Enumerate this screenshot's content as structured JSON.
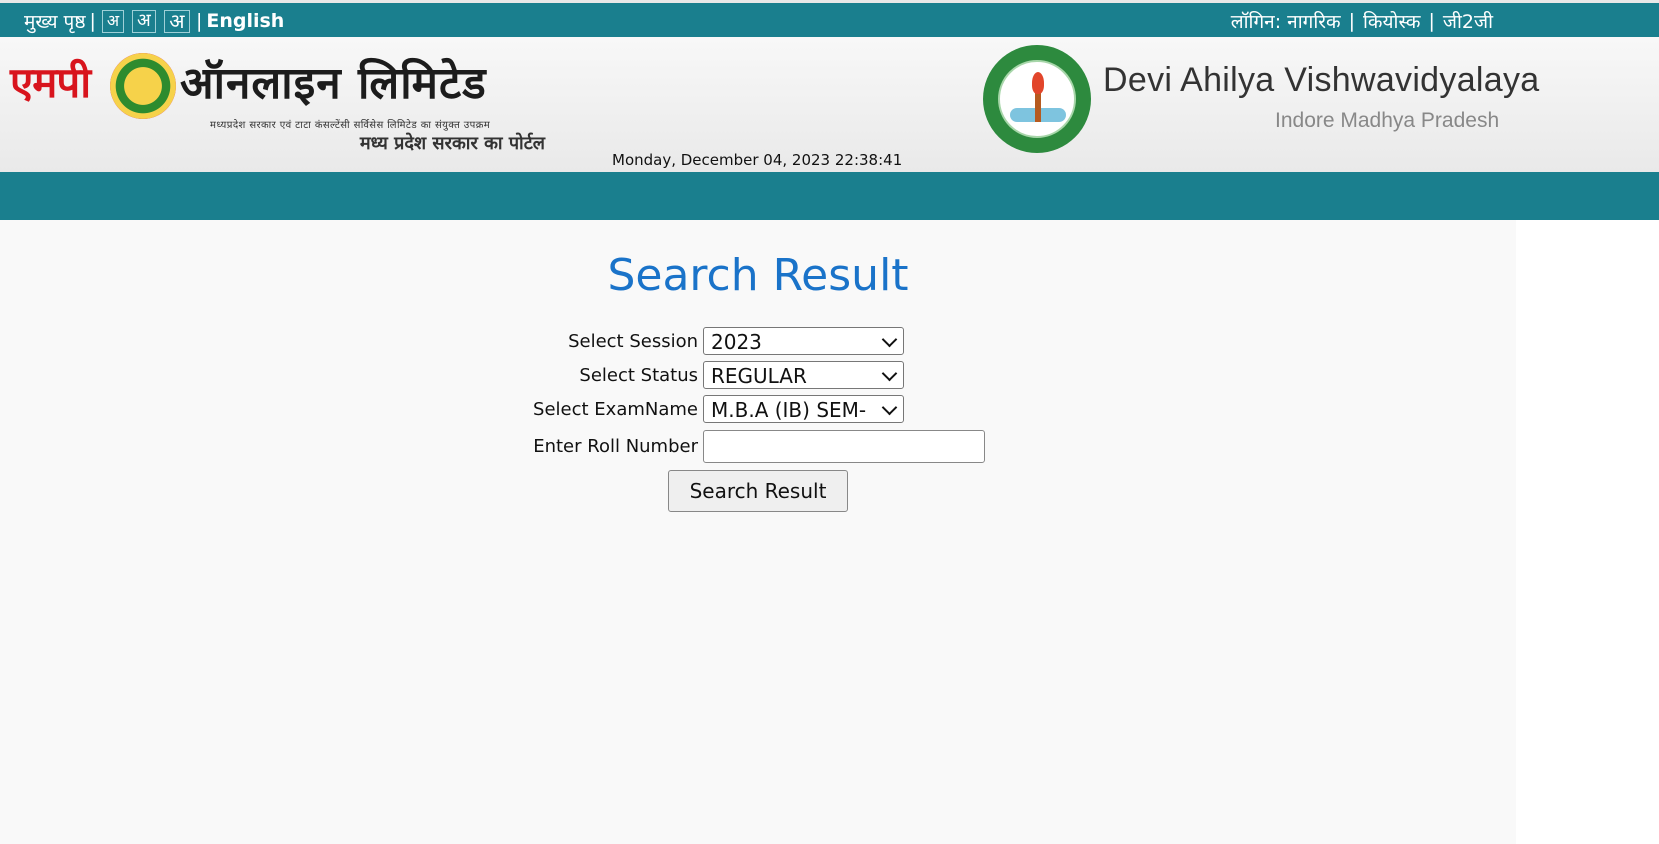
{
  "topbar": {
    "home_label": "मुख्य पृष्ठ",
    "font_small": "अ",
    "font_medium": "अ",
    "font_large": "अ",
    "english_label": "English",
    "login_label": "लॉगिन: नागरिक",
    "kiosk_label": "कियोस्क",
    "g2g_label": "जी2जी"
  },
  "header": {
    "mp_logo_word1": "एमपी",
    "mp_logo_word2": "ऑनलाइन  लिमिटेड",
    "mp_tagline": "मध्यप्रदेश सरकार एवं टाटा कंसल्टेंसी सर्विसेस लिमिटेड का संयुक्त उपक्रम",
    "mp_portal": "मध्य प्रदेश सरकार का पोर्टल",
    "datetime": "Monday, December 04, 2023 22:38:41",
    "university_name": "Devi Ahilya Vishwavidyalaya",
    "university_location": "Indore Madhya Pradesh"
  },
  "main": {
    "title": "Search Result",
    "session_label": "Select Session",
    "session_value": "2023",
    "status_label": "Select Status",
    "status_value": "REGULAR",
    "exam_label": "Select ExamName",
    "exam_value": "M.B.A (IB) SEM-",
    "roll_label": "Enter Roll Number",
    "roll_value": "",
    "search_button": "Search Result"
  },
  "colors": {
    "bar": "#1a7f8e",
    "title": "#1a73c9",
    "logo_red": "#d8141d",
    "seal_green": "#2d8a3e"
  }
}
